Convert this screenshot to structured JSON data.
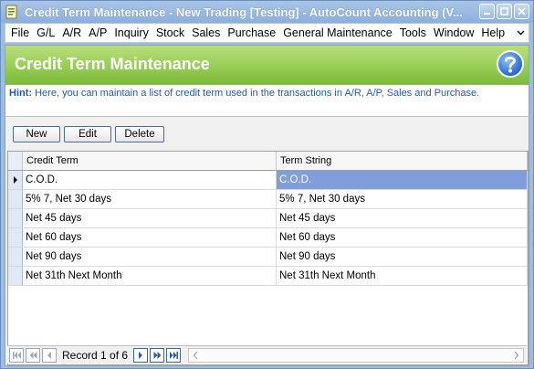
{
  "window": {
    "title": "Credit Term Maintenance - New Trading  [Testing] - AutoCount Accounting (V..."
  },
  "menu": {
    "items": [
      {
        "label": "File"
      },
      {
        "label": "G/L"
      },
      {
        "label": "A/R"
      },
      {
        "label": "A/P"
      },
      {
        "label": "Inquiry"
      },
      {
        "label": "Stock"
      },
      {
        "label": "Sales"
      },
      {
        "label": "Purchase"
      },
      {
        "label": "General Maintenance"
      },
      {
        "label": "Tools"
      },
      {
        "label": "Window"
      },
      {
        "label": "Help"
      }
    ]
  },
  "header": {
    "title": "Credit Term Maintenance"
  },
  "hint": {
    "label": "Hint:",
    "text": "Here, you can maintain a list of credit term used in the transactions in A/R, A/P, Sales and Purchase."
  },
  "toolbar": {
    "new_label": "New",
    "edit_label": "Edit",
    "delete_label": "Delete"
  },
  "grid": {
    "columns": [
      "Credit Term",
      "Term String"
    ],
    "rows": [
      {
        "credit_term": "C.O.D.",
        "term_string": "C.O.D."
      },
      {
        "credit_term": "5% 7, Net 30 days",
        "term_string": "5% 7, Net 30 days"
      },
      {
        "credit_term": "Net 45 days",
        "term_string": "Net 45 days"
      },
      {
        "credit_term": "Net 60 days",
        "term_string": "Net 60 days"
      },
      {
        "credit_term": "Net 90 days",
        "term_string": "Net 90 days"
      },
      {
        "credit_term": "Net 31th Next Month",
        "term_string": "Net 31th Next Month"
      }
    ]
  },
  "navigator": {
    "record_text": "Record 1 of 6"
  },
  "colors": {
    "header_green_top": "#b8e07a",
    "header_green_bottom": "#7cbc3a",
    "selection": "#7f9edb",
    "hint_text": "#1e5ab4"
  }
}
